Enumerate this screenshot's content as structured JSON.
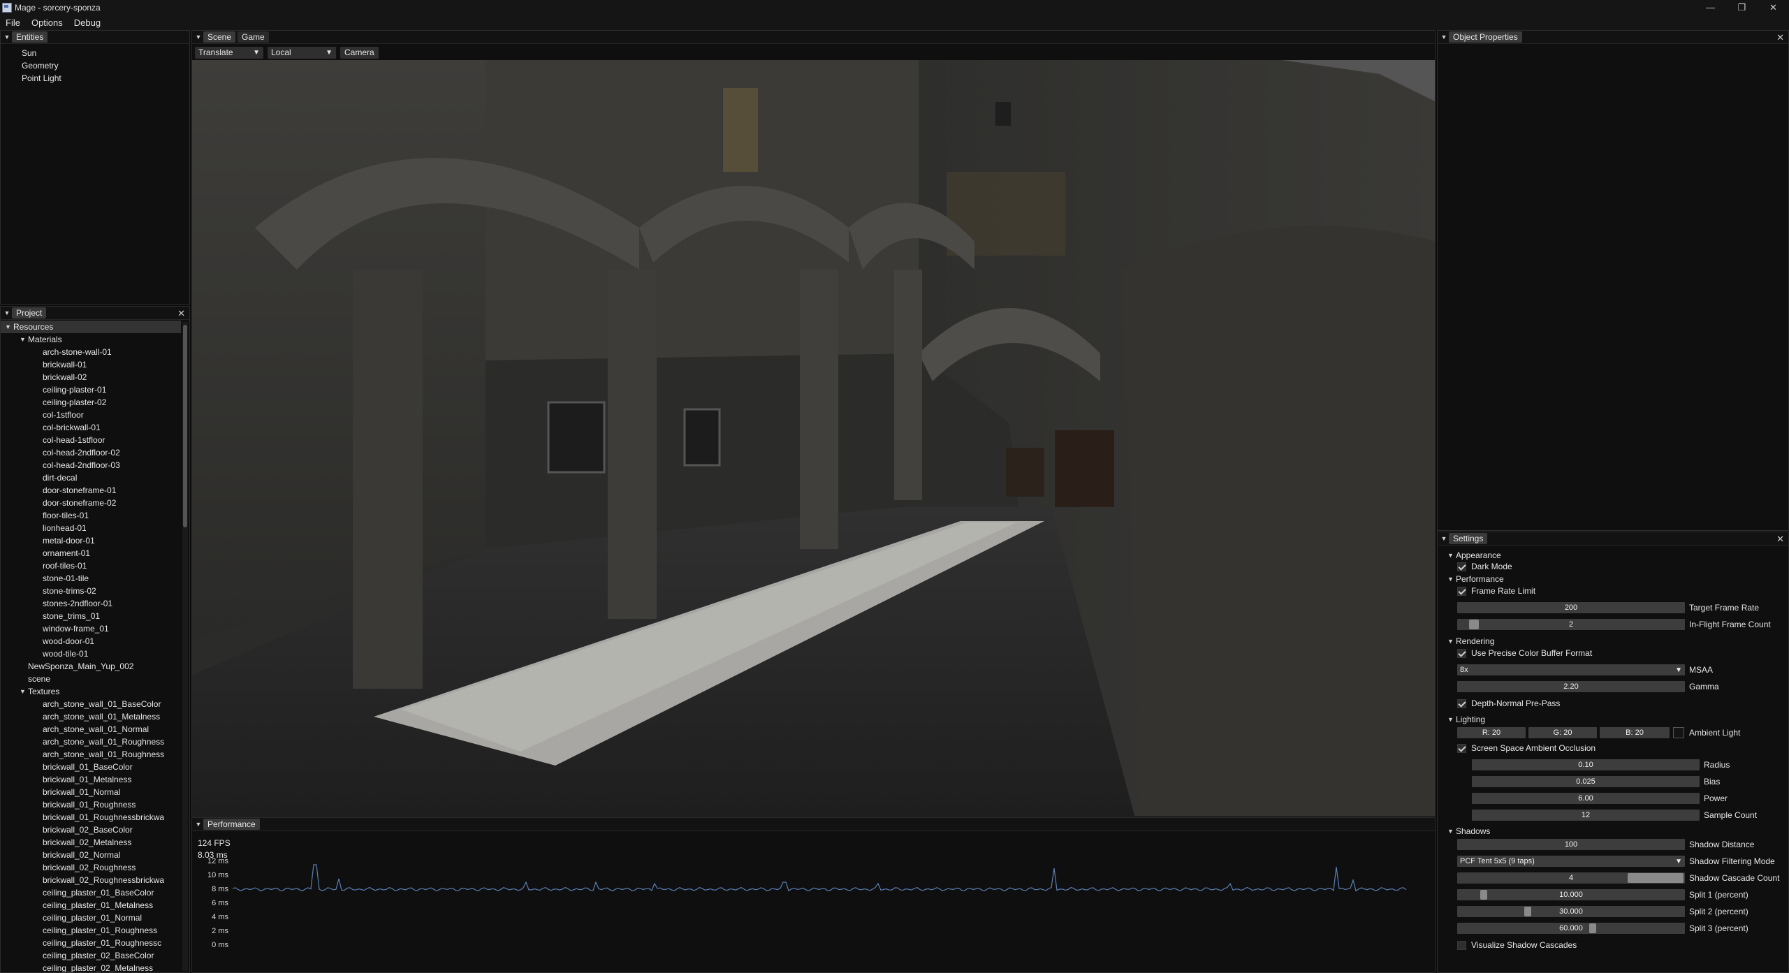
{
  "window": {
    "title": "Mage - sorcery-sponza",
    "minimize": "—",
    "maximize": "❐",
    "close": "✕"
  },
  "menu": [
    "File",
    "Options",
    "Debug"
  ],
  "entities": {
    "tab": "Entities",
    "items": [
      "Sun",
      "Geometry",
      "Point Light"
    ]
  },
  "project": {
    "tab": "Project",
    "tree": [
      {
        "label": "Resources",
        "depth": 0,
        "expanded": true,
        "selected": true
      },
      {
        "label": "Materials",
        "depth": 1,
        "expanded": true
      },
      {
        "label": "arch-stone-wall-01",
        "depth": 2
      },
      {
        "label": "brickwall-01",
        "depth": 2
      },
      {
        "label": "brickwall-02",
        "depth": 2
      },
      {
        "label": "ceiling-plaster-01",
        "depth": 2
      },
      {
        "label": "ceiling-plaster-02",
        "depth": 2
      },
      {
        "label": "col-1stfloor",
        "depth": 2
      },
      {
        "label": "col-brickwall-01",
        "depth": 2
      },
      {
        "label": "col-head-1stfloor",
        "depth": 2
      },
      {
        "label": "col-head-2ndfloor-02",
        "depth": 2
      },
      {
        "label": "col-head-2ndfloor-03",
        "depth": 2
      },
      {
        "label": "dirt-decal",
        "depth": 2
      },
      {
        "label": "door-stoneframe-01",
        "depth": 2
      },
      {
        "label": "door-stoneframe-02",
        "depth": 2
      },
      {
        "label": "floor-tiles-01",
        "depth": 2
      },
      {
        "label": "lionhead-01",
        "depth": 2
      },
      {
        "label": "metal-door-01",
        "depth": 2
      },
      {
        "label": "ornament-01",
        "depth": 2
      },
      {
        "label": "roof-tiles-01",
        "depth": 2
      },
      {
        "label": "stone-01-tile",
        "depth": 2
      },
      {
        "label": "stone-trims-02",
        "depth": 2
      },
      {
        "label": "stones-2ndfloor-01",
        "depth": 2
      },
      {
        "label": "stone_trims_01",
        "depth": 2
      },
      {
        "label": "window-frame_01",
        "depth": 2
      },
      {
        "label": "wood-door-01",
        "depth": 2
      },
      {
        "label": "wood-tile-01",
        "depth": 2
      },
      {
        "label": "NewSponza_Main_Yup_002",
        "depth": 1
      },
      {
        "label": "scene",
        "depth": 1
      },
      {
        "label": "Textures",
        "depth": 1,
        "expanded": true
      },
      {
        "label": "arch_stone_wall_01_BaseColor",
        "depth": 2
      },
      {
        "label": "arch_stone_wall_01_Metalness",
        "depth": 2
      },
      {
        "label": "arch_stone_wall_01_Normal",
        "depth": 2
      },
      {
        "label": "arch_stone_wall_01_Roughness",
        "depth": 2
      },
      {
        "label": "arch_stone_wall_01_Roughness",
        "depth": 2
      },
      {
        "label": "brickwall_01_BaseColor",
        "depth": 2
      },
      {
        "label": "brickwall_01_Metalness",
        "depth": 2
      },
      {
        "label": "brickwall_01_Normal",
        "depth": 2
      },
      {
        "label": "brickwall_01_Roughness",
        "depth": 2
      },
      {
        "label": "brickwall_01_Roughnessbrickwa",
        "depth": 2
      },
      {
        "label": "brickwall_02_BaseColor",
        "depth": 2
      },
      {
        "label": "brickwall_02_Metalness",
        "depth": 2
      },
      {
        "label": "brickwall_02_Normal",
        "depth": 2
      },
      {
        "label": "brickwall_02_Roughness",
        "depth": 2
      },
      {
        "label": "brickwall_02_Roughnessbrickwa",
        "depth": 2
      },
      {
        "label": "ceiling_plaster_01_BaseColor",
        "depth": 2
      },
      {
        "label": "ceiling_plaster_01_Metalness",
        "depth": 2
      },
      {
        "label": "ceiling_plaster_01_Normal",
        "depth": 2
      },
      {
        "label": "ceiling_plaster_01_Roughness",
        "depth": 2
      },
      {
        "label": "ceiling_plaster_01_Roughnessc",
        "depth": 2
      },
      {
        "label": "ceiling_plaster_02_BaseColor",
        "depth": 2
      },
      {
        "label": "ceiling_plaster_02_Metalness",
        "depth": 2
      }
    ]
  },
  "scene": {
    "tabs": [
      {
        "label": "Scene",
        "active": true
      },
      {
        "label": "Game",
        "active": false
      }
    ],
    "toolbar": {
      "mode": "Translate",
      "space": "Local",
      "camera_button": "Camera"
    }
  },
  "object_properties": {
    "tab": "Object Properties"
  },
  "performance": {
    "tab": "Performance",
    "fps": "124 FPS",
    "frame_time": "8.03 ms",
    "y_ticks": [
      "12 ms",
      "10 ms",
      "8 ms",
      "6 ms",
      "4 ms",
      "2 ms",
      "0 ms"
    ],
    "line_color": "#5b7fb5",
    "baseline_ms": 8.0,
    "spikes": [
      [
        0.07,
        11.5
      ],
      [
        0.09,
        9.5
      ],
      [
        0.25,
        9.0
      ],
      [
        0.31,
        9.0
      ],
      [
        0.36,
        8.8
      ],
      [
        0.47,
        9.0
      ],
      [
        0.55,
        8.8
      ],
      [
        0.7,
        11.0
      ],
      [
        0.85,
        8.8
      ],
      [
        0.94,
        11.2
      ],
      [
        0.955,
        9.3
      ]
    ]
  },
  "settings": {
    "tab": "Settings",
    "sections": {
      "appearance": "Appearance",
      "performance": "Performance",
      "rendering": "Rendering",
      "lighting": "Lighting",
      "shadows": "Shadows"
    },
    "dark_mode": {
      "label": "Dark Mode",
      "checked": true
    },
    "frame_rate_limit": {
      "label": "Frame Rate Limit",
      "checked": true
    },
    "target_frame_rate": {
      "label": "Target Frame Rate",
      "value": "200"
    },
    "in_flight_frame_count": {
      "label": "In-Flight Frame Count",
      "value": "2",
      "fraction": 0.05
    },
    "precise_color": {
      "label": "Use Precise Color Buffer Format",
      "checked": true
    },
    "msaa": {
      "label": "MSAA",
      "value": "8x"
    },
    "gamma": {
      "label": "Gamma",
      "value": "2.20"
    },
    "depth_prepass": {
      "label": "Depth-Normal Pre-Pass",
      "checked": true
    },
    "ambient": {
      "r": "R: 20",
      "g": "G: 20",
      "b": "B: 20",
      "label": "Ambient Light",
      "swatch": "#141414"
    },
    "ssao": {
      "label": "Screen Space Ambient Occlusion",
      "checked": true
    },
    "radius": {
      "label": "Radius",
      "value": "0.10"
    },
    "bias": {
      "label": "Bias",
      "value": "0.025"
    },
    "power": {
      "label": "Power",
      "value": "6.00"
    },
    "sample_count": {
      "label": "Sample Count",
      "value": "12"
    },
    "shadow_distance": {
      "label": "Shadow Distance",
      "value": "100"
    },
    "shadow_filtering": {
      "label": "Shadow Filtering Mode",
      "value": "PCF Tent 5x5 (9 taps)"
    },
    "cascade_count": {
      "label": "Shadow Cascade Count",
      "value": "4",
      "fraction": 1.0
    },
    "split1": {
      "label": "Split 1 (percent)",
      "value": "10.000",
      "fraction": 0.1
    },
    "split2": {
      "label": "Split 2 (percent)",
      "value": "30.000",
      "fraction": 0.3
    },
    "split3": {
      "label": "Split 3 (percent)",
      "value": "60.000",
      "fraction": 0.6
    },
    "visualize_cascades": {
      "label": "Visualize Shadow Cascades",
      "checked": false
    }
  }
}
